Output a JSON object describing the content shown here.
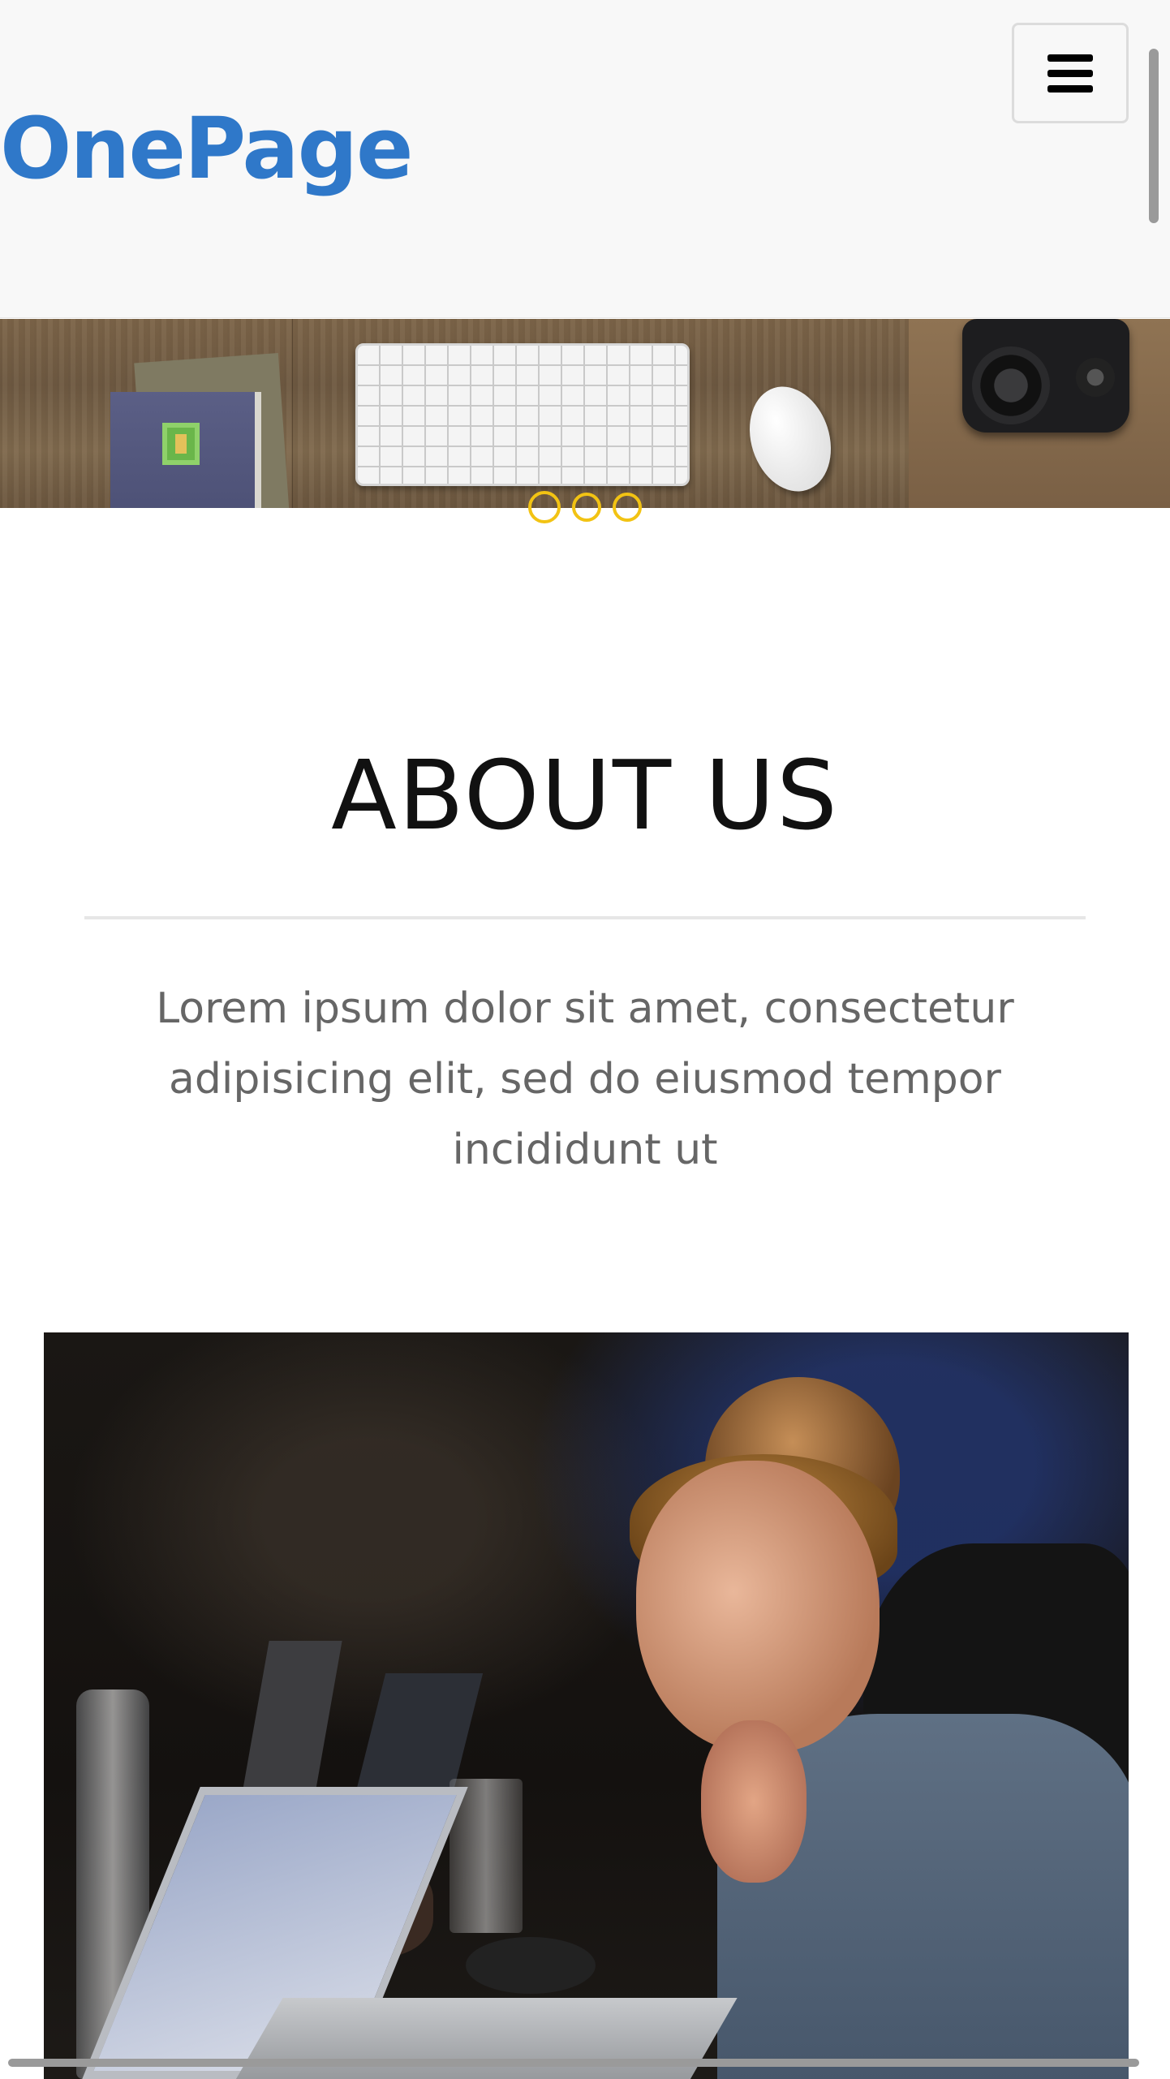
{
  "header": {
    "brand": "OnePage",
    "menu_icon": "hamburger-menu-icon"
  },
  "hero": {
    "slides_count": 3,
    "active_slide": 1
  },
  "about": {
    "title": "ABOUT US",
    "text": "Lorem ipsum dolor sit amet, consectetur adipisicing elit, sed do eiusmod tempor incididunt ut"
  },
  "colors": {
    "brand": "#2f78c9",
    "dot_accent": "#f2c313",
    "header_bg": "#f8f8f8",
    "body_text": "#666666"
  }
}
